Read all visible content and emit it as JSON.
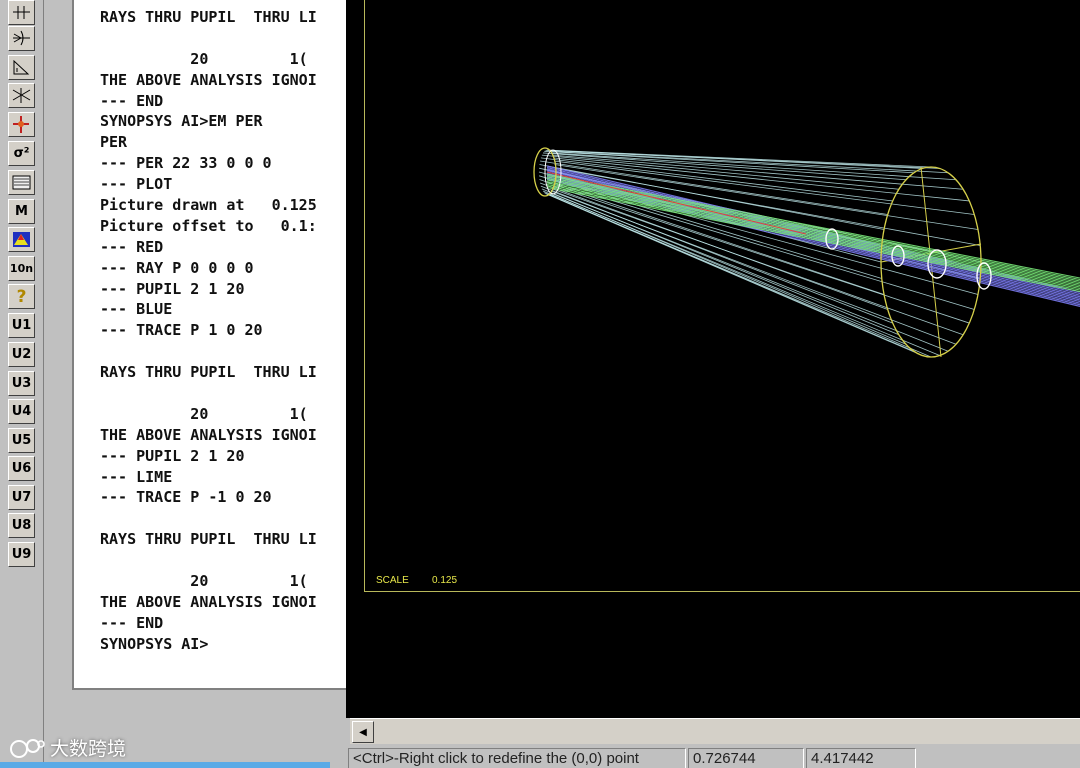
{
  "toolbar": {
    "buttons": [
      {
        "name": "lens-pair-icon"
      },
      {
        "name": "converging-lens-icon"
      },
      {
        "name": "prism-icon"
      },
      {
        "name": "diverging-lens-icon"
      },
      {
        "name": "beam-icon"
      },
      {
        "name": "sigma-squared-icon",
        "label": "σ²"
      },
      {
        "name": "spectrum-icon"
      },
      {
        "name": "macro-button",
        "label": "M"
      },
      {
        "name": "color-triangle-icon"
      },
      {
        "name": "ion-button",
        "label": "10n"
      },
      {
        "name": "help-icon",
        "label": "?"
      },
      {
        "name": "user-macro-u1",
        "label": "U1"
      },
      {
        "name": "user-macro-u2",
        "label": "U2"
      },
      {
        "name": "user-macro-u3",
        "label": "U3"
      },
      {
        "name": "user-macro-u4",
        "label": "U4"
      },
      {
        "name": "user-macro-u5",
        "label": "U5"
      },
      {
        "name": "user-macro-u6",
        "label": "U6"
      },
      {
        "name": "user-macro-u7",
        "label": "U7"
      },
      {
        "name": "user-macro-u8",
        "label": "U8"
      },
      {
        "name": "user-macro-u9",
        "label": "U9"
      }
    ]
  },
  "console": {
    "lines": [
      "RAYS THRU PUPIL  THRU LI",
      "",
      "          20         1(",
      "THE ABOVE ANALYSIS IGNOI",
      "--- END",
      "SYNOPSYS AI>EM PER",
      "PER",
      "--- PER 22 33 0 0 0",
      "--- PLOT",
      "Picture drawn at   0.125",
      "Picture offset to   0.1:",
      "--- RED",
      "--- RAY P 0 0 0 0",
      "--- PUPIL 2 1 20",
      "--- BLUE",
      "--- TRACE P 1 0 20",
      "",
      "RAYS THRU PUPIL  THRU LI",
      "",
      "          20         1(",
      "THE ABOVE ANALYSIS IGNOI",
      "--- PUPIL 2 1 20",
      "--- LIME",
      "--- TRACE P -1 0 20",
      "",
      "RAYS THRU PUPIL  THRU LI",
      "",
      "          20         1(",
      "THE ABOVE ANALYSIS IGNOI",
      "--- END",
      "SYNOPSYS AI>"
    ]
  },
  "plot": {
    "scale_label": "SCALE",
    "scale_value": "0.125",
    "colors": {
      "border": "#b8b85a",
      "cone": "#bfe8ea",
      "aperture": "#d6d04a",
      "blue_rays": "#7a7af0",
      "lime_rays": "#78e878",
      "red_ray": "#e04040"
    }
  },
  "status": {
    "hint": "<Ctrl>-Right click to redefine the (0,0) point",
    "x_value": "0.726744",
    "y_value": "4.417442"
  },
  "watermark": {
    "text": "大数跨境"
  }
}
